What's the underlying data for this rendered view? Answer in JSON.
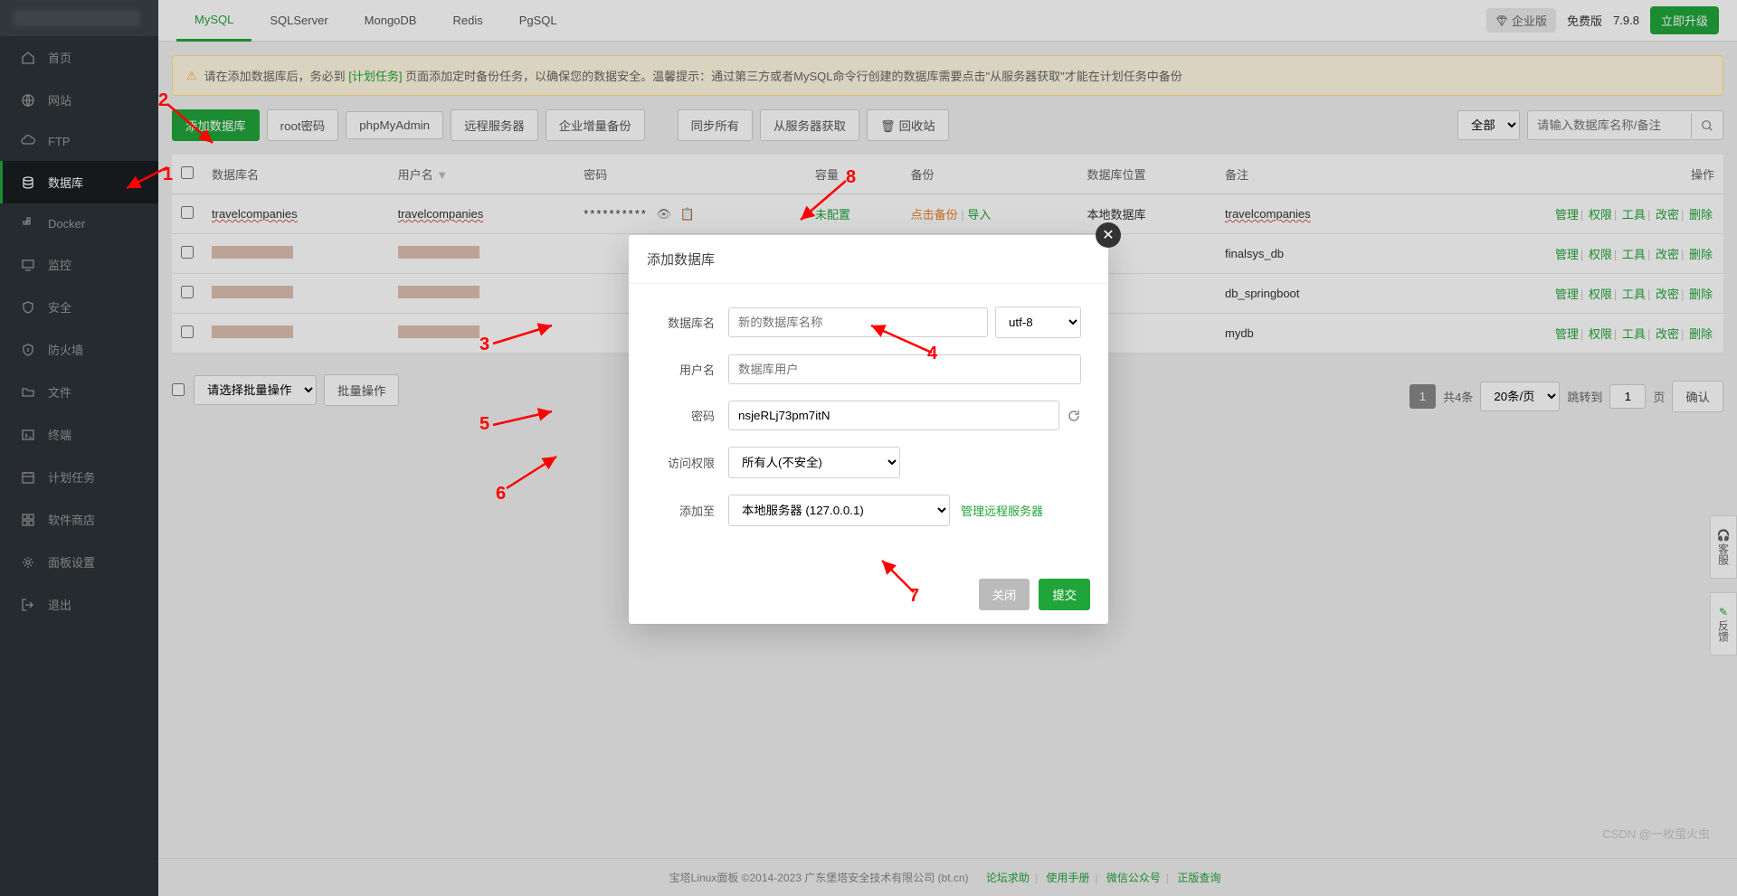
{
  "sidebar": {
    "items": [
      {
        "label": "首页",
        "icon": "home"
      },
      {
        "label": "网站",
        "icon": "globe"
      },
      {
        "label": "FTP",
        "icon": "cloud"
      },
      {
        "label": "数据库",
        "icon": "database",
        "active": true
      },
      {
        "label": "Docker",
        "icon": "docker"
      },
      {
        "label": "监控",
        "icon": "monitor"
      },
      {
        "label": "安全",
        "icon": "shield"
      },
      {
        "label": "防火墙",
        "icon": "firewall"
      },
      {
        "label": "文件",
        "icon": "folder"
      },
      {
        "label": "终端",
        "icon": "terminal"
      },
      {
        "label": "计划任务",
        "icon": "calendar"
      },
      {
        "label": "软件商店",
        "icon": "apps"
      },
      {
        "label": "面板设置",
        "icon": "gear"
      },
      {
        "label": "退出",
        "icon": "exit"
      }
    ]
  },
  "tabs": [
    "MySQL",
    "SQLServer",
    "MongoDB",
    "Redis",
    "PgSQL"
  ],
  "activeTab": "MySQL",
  "topright": {
    "enterprise": "企业版",
    "free": "免费版",
    "version": "7.9.8",
    "upgrade": "立即升级"
  },
  "alert": {
    "prefix": "请在添加数据库后，务必到",
    "linkText": "[计划任务]",
    "middle": "页面添加定时备份任务，以确保您的数据安全。温馨提示：通过第三方或者MySQL命令行创建的数据库需要点击\"从服务器获取\"才能在计划任务中备份"
  },
  "toolbar": {
    "add": "添加数据库",
    "rootPw": "root密码",
    "phpMyAdmin": "phpMyAdmin",
    "remote": "远程服务器",
    "incBackup": "企业增量备份",
    "syncAll": "同步所有",
    "getFromServer": "从服务器获取",
    "recycle": "回收站",
    "filterAll": "全部",
    "searchPlaceholder": "请输入数据库名称/备注"
  },
  "columns": {
    "name": "数据库名",
    "user": "用户名",
    "password": "密码",
    "capacity": "容量",
    "backup": "备份",
    "location": "数据库位置",
    "remark": "备注",
    "actions": "操作"
  },
  "rows": [
    {
      "name": "travelcompanies",
      "user": "travelcompanies",
      "pw": "**********",
      "capacity": "未配置",
      "backup_a": "点击备份",
      "backup_b": "导入",
      "location": "本地数据库",
      "remark": "travelcompanies"
    },
    {
      "name": "",
      "user": "",
      "remark": "finalsys_db",
      "blurred": true
    },
    {
      "name": "",
      "user": "",
      "remark": "db_springboot",
      "blurred": true
    },
    {
      "name": "",
      "user": "",
      "remark": "mydb",
      "blurred": true
    }
  ],
  "rowActions": {
    "manage": "管理",
    "perms": "权限",
    "tools": "工具",
    "chpw": "改密",
    "delete": "删除"
  },
  "batch": {
    "select": "请选择批量操作",
    "btn": "批量操作"
  },
  "pagination": {
    "page": "1",
    "total": "共4条",
    "perPage": "20条/页",
    "jumpTo": "跳转到",
    "pageInput": "1",
    "pageUnit": "页",
    "confirm": "确认"
  },
  "modal": {
    "title": "添加数据库",
    "labels": {
      "dbName": "数据库名",
      "user": "用户名",
      "password": "密码",
      "access": "访问权限",
      "addTo": "添加至"
    },
    "placeholders": {
      "dbName": "新的数据库名称",
      "user": "数据库用户"
    },
    "values": {
      "charset": "utf-8",
      "password": "nsjeRLj73pm7itN",
      "access": "所有人(不安全)",
      "addTo": "本地服务器 (127.0.0.1)"
    },
    "manageRemote": "管理远程服务器",
    "close": "关闭",
    "submit": "提交"
  },
  "sidePanel": [
    {
      "icon": "headset",
      "label": "客服"
    },
    {
      "icon": "edit",
      "label": "反馈"
    }
  ],
  "footer": {
    "text": "宝塔Linux面板 ©2014-2023 广东堡塔安全技术有限公司 (bt.cn)",
    "links": [
      "论坛求助",
      "使用手册",
      "微信公众号",
      "正版查询"
    ]
  },
  "watermark": "CSDN @一枚萤火虫",
  "annotations": [
    "1",
    "2",
    "3",
    "4",
    "5",
    "6",
    "7",
    "8"
  ]
}
